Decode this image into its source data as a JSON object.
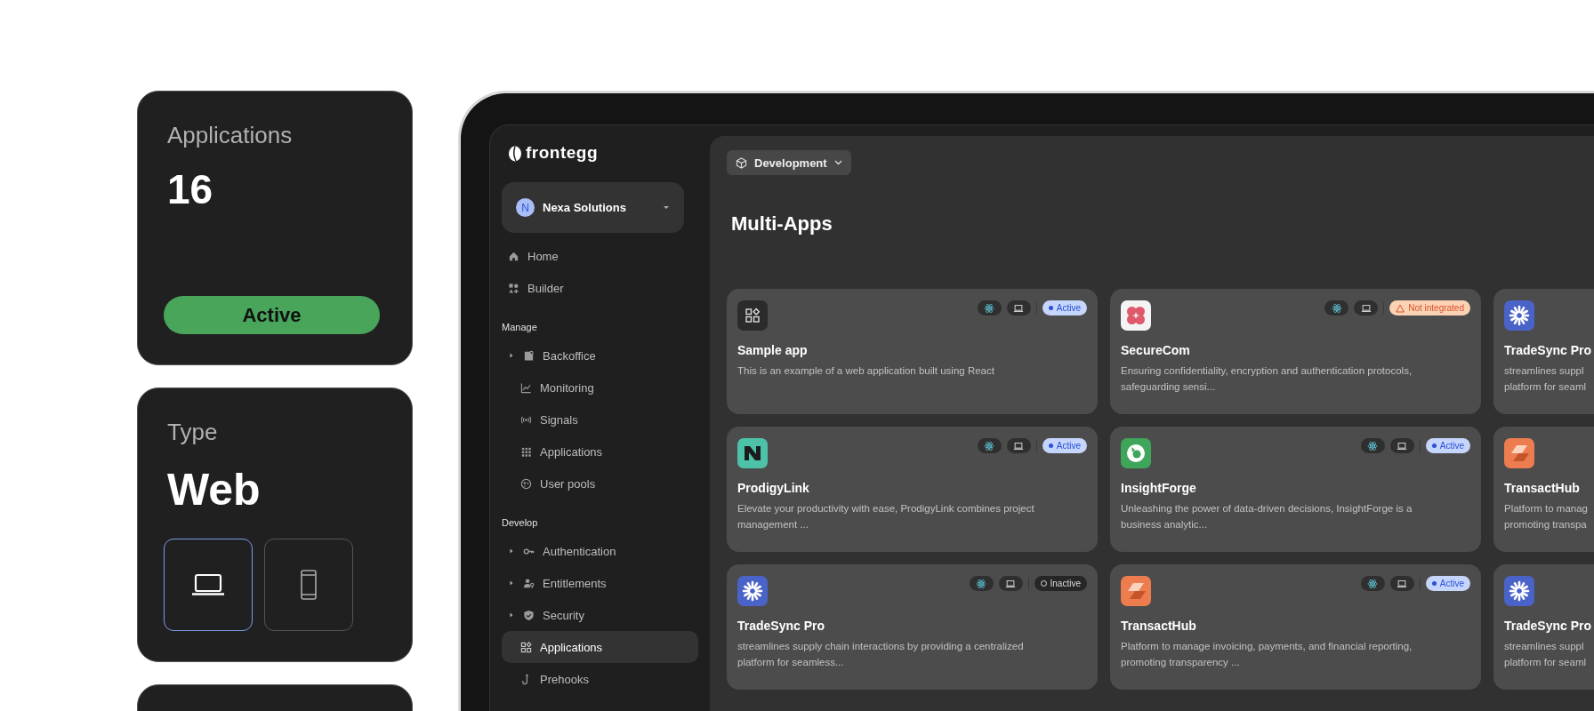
{
  "summary_cards": [
    {
      "kind": "count",
      "label": "Applications",
      "value": "16",
      "button": "Active"
    },
    {
      "kind": "type",
      "label": "Type",
      "value": "Web",
      "options": [
        {
          "kind": "laptop",
          "selected": true
        },
        {
          "kind": "phone",
          "selected": false
        }
      ]
    },
    {
      "kind": "empty"
    }
  ],
  "app": {
    "logo": "frontegg",
    "org": {
      "initial": "N",
      "name": "Nexa Solutions"
    },
    "sidebar": [
      {
        "items": [
          {
            "kind": "home",
            "label": "Home",
            "expandable": false,
            "selected": false
          },
          {
            "kind": "builder",
            "label": "Builder",
            "expandable": false,
            "selected": false
          }
        ]
      },
      {
        "title": "Manage",
        "items": [
          {
            "kind": "backoffice",
            "label": "Backoffice",
            "expandable": true,
            "selected": false
          },
          {
            "kind": "chart",
            "label": "Monitoring",
            "expandable": false,
            "selected": false
          },
          {
            "kind": "signal",
            "label": "Signals",
            "expandable": false,
            "selected": false
          },
          {
            "kind": "grid9",
            "label": "Applications",
            "expandable": false,
            "selected": false
          },
          {
            "kind": "pool",
            "label": "User pools",
            "expandable": false,
            "selected": false
          }
        ]
      },
      {
        "title": "Develop",
        "items": [
          {
            "kind": "key",
            "label": "Authentication",
            "expandable": true,
            "selected": false
          },
          {
            "kind": "user",
            "label": "Entitlements",
            "expandable": true,
            "selected": false
          },
          {
            "kind": "shield",
            "label": "Security",
            "expandable": true,
            "selected": false
          },
          {
            "kind": "apps",
            "label": "Applications",
            "expandable": false,
            "selected": true
          },
          {
            "kind": "hook",
            "label": "Prehooks",
            "expandable": false,
            "selected": false
          }
        ]
      }
    ],
    "environment": "Development",
    "title": "Multi-Apps",
    "cards": [
      {
        "kind": "apps",
        "name": "Sample app",
        "description": "This is an example of a web application built using React",
        "platforms": [
          {
            "kind": "react"
          },
          {
            "kind": "laptop"
          }
        ],
        "status": {
          "kind": "active",
          "label": "Active"
        }
      },
      {
        "kind": "petals",
        "name": "SecureCom",
        "description": "Ensuring confidentiality, encryption and authentication protocols, safeguarding sensi...",
        "platforms": [
          {
            "kind": "react"
          },
          {
            "kind": "laptop"
          }
        ],
        "status": {
          "kind": "warning",
          "label": "Not integrated"
        }
      },
      {
        "kind": "spark",
        "name": "TradeSync Pro",
        "description": "streamlines suppl platform for seaml"
      },
      {
        "kind": "n-logo",
        "name": "ProdigyLink",
        "description": "Elevate your productivity with ease, ProdigyLink combines project management ...",
        "platforms": [
          {
            "kind": "react"
          },
          {
            "kind": "laptop"
          }
        ],
        "status": {
          "kind": "active",
          "label": "Active"
        }
      },
      {
        "kind": "ring",
        "name": "InsightForge",
        "description": "Unleashing the power of data-driven decisions, InsightForge is a business analytic...",
        "platforms": [
          {
            "kind": "react"
          },
          {
            "kind": "laptop"
          }
        ],
        "status": {
          "kind": "active",
          "label": "Active"
        }
      },
      {
        "kind": "slab",
        "name": "TransactHub",
        "description": "Platform to manag promoting transpa"
      },
      {
        "kind": "spark",
        "name": "TradeSync Pro",
        "description": "streamlines supply chain interactions by providing a centralized platform for seamless...",
        "platforms": [
          {
            "kind": "react"
          },
          {
            "kind": "laptop"
          }
        ],
        "status": {
          "kind": "inactive",
          "label": "Inactive"
        }
      },
      {
        "kind": "slab",
        "name": "TransactHub",
        "description": "Platform to manage invoicing, payments, and financial reporting, promoting transparency ...",
        "platforms": [
          {
            "kind": "react"
          },
          {
            "kind": "laptop"
          }
        ],
        "status": {
          "kind": "active",
          "label": "Active"
        }
      },
      {
        "kind": "spark",
        "name": "TradeSync Pro",
        "description": "streamlines suppl platform for seaml"
      }
    ]
  }
}
